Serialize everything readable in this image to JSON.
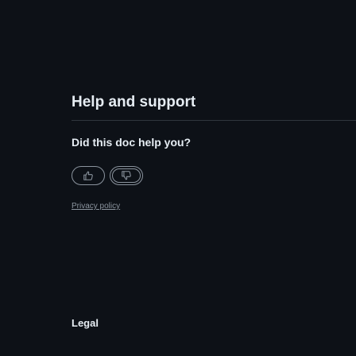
{
  "support": {
    "title": "Help and support"
  },
  "feedback": {
    "question": "Did this doc help you?",
    "thumbs_up_icon": "thumbs-up-icon",
    "thumbs_down_icon": "thumbs-down-icon",
    "privacy_label": "Privacy policy"
  },
  "footer": {
    "legal_heading": "Legal"
  },
  "colors": {
    "background": "#0d1117",
    "text": "#e6edf3",
    "muted": "#8b949e",
    "border": "#30363d"
  }
}
